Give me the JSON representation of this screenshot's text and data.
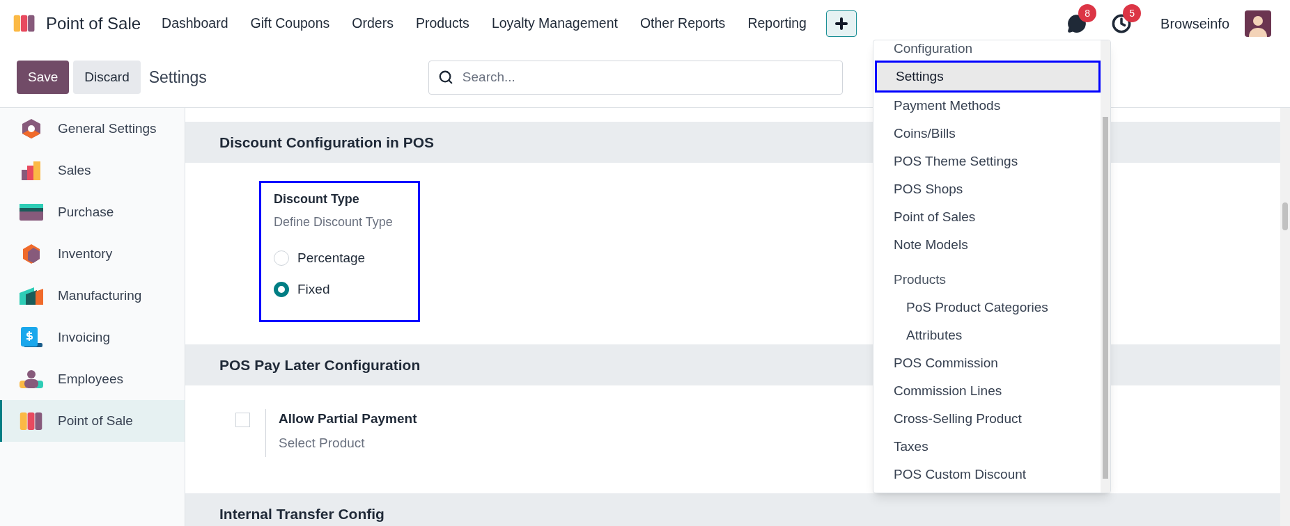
{
  "app": {
    "name": "Point of Sale"
  },
  "nav_menus": [
    {
      "label": "Dashboard"
    },
    {
      "label": "Gift Coupons"
    },
    {
      "label": "Orders"
    },
    {
      "label": "Products"
    },
    {
      "label": "Loyalty Management"
    },
    {
      "label": "Other Reports"
    },
    {
      "label": "Reporting"
    }
  ],
  "systray": {
    "messages_badge": "8",
    "activities_badge": "5",
    "user": "Browseinfo"
  },
  "toolbar": {
    "save": "Save",
    "discard": "Discard",
    "breadcrumb": "Settings",
    "search_placeholder": "Search..."
  },
  "sidebar": {
    "items": [
      {
        "label": "General Settings",
        "selected": false
      },
      {
        "label": "Sales",
        "selected": false
      },
      {
        "label": "Purchase",
        "selected": false
      },
      {
        "label": "Inventory",
        "selected": false
      },
      {
        "label": "Manufacturing",
        "selected": false
      },
      {
        "label": "Invoicing",
        "selected": false
      },
      {
        "label": "Employees",
        "selected": false
      },
      {
        "label": "Point of Sale",
        "selected": true
      }
    ]
  },
  "sections": [
    {
      "title": "Discount Configuration in POS",
      "settings": [
        {
          "kind": "radio",
          "title": "Discount Type",
          "description": "Define Discount Type",
          "highlighted": true,
          "options": [
            {
              "label": "Percentage",
              "selected": false
            },
            {
              "label": "Fixed",
              "selected": true
            }
          ]
        }
      ]
    },
    {
      "title": "POS Pay Later Configuration",
      "settings": [
        {
          "kind": "checkbox",
          "title": "Allow Partial Payment",
          "description": "Select Product",
          "checked": false
        }
      ]
    },
    {
      "title": "Internal Transfer Config"
    }
  ],
  "dropdown": {
    "entries": [
      {
        "kind": "heading",
        "label": "Configuration"
      },
      {
        "kind": "item",
        "label": "Settings",
        "selected": true,
        "highlighted": true
      },
      {
        "kind": "item",
        "label": "Payment Methods",
        "selected": false
      },
      {
        "kind": "item",
        "label": "Coins/Bills",
        "selected": false
      },
      {
        "kind": "item",
        "label": "POS Theme Settings",
        "selected": false
      },
      {
        "kind": "item",
        "label": "POS Shops",
        "selected": false
      },
      {
        "kind": "item",
        "label": "Point of Sales",
        "selected": false
      },
      {
        "kind": "item",
        "label": "Note Models",
        "selected": false
      },
      {
        "kind": "heading",
        "label": "Products"
      },
      {
        "kind": "subitem",
        "label": "PoS Product Categories",
        "selected": false
      },
      {
        "kind": "subitem",
        "label": "Attributes",
        "selected": false
      },
      {
        "kind": "item",
        "label": "POS Commission",
        "selected": false
      },
      {
        "kind": "item",
        "label": "Commission Lines",
        "selected": false
      },
      {
        "kind": "item",
        "label": "Cross-Selling Product",
        "selected": false
      },
      {
        "kind": "item",
        "label": "Taxes",
        "selected": false
      },
      {
        "kind": "item",
        "label": "POS Custom Discount",
        "selected": false
      }
    ]
  }
}
